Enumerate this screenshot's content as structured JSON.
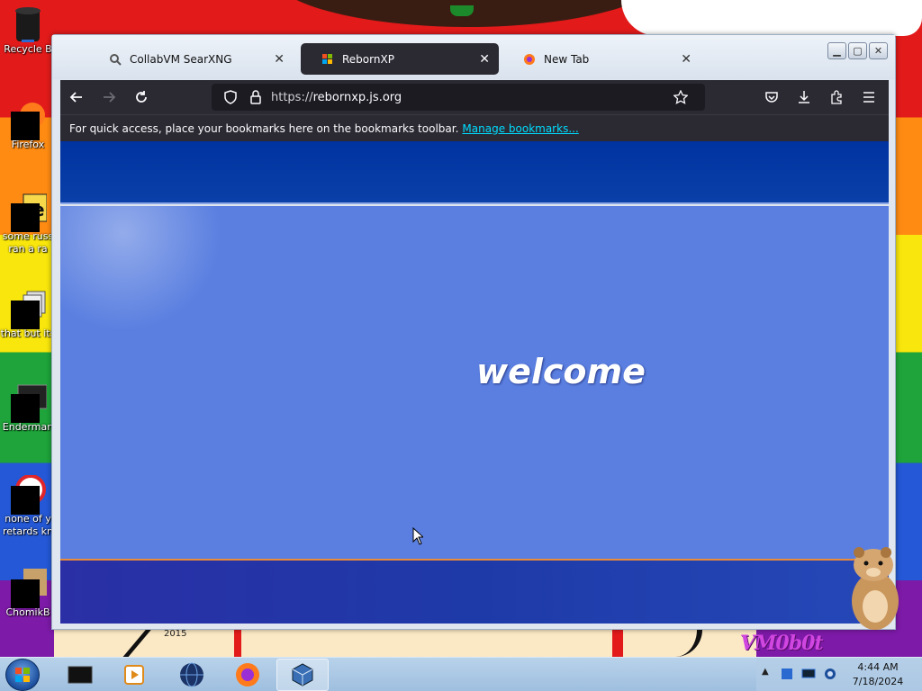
{
  "desktop": {
    "icons": [
      {
        "label": "Recycle B"
      },
      {
        "label": "Firefox"
      },
      {
        "label": "some russ ran a ra"
      },
      {
        "label": "that but its"
      },
      {
        "label": "Enderman"
      },
      {
        "label": "none of y retards kn"
      },
      {
        "label": "ChomikB"
      }
    ],
    "year_label": "2015",
    "vm_label": "VM0b0t"
  },
  "browser": {
    "tabs": [
      {
        "label": "CollabVM SearXNG",
        "icon": "searxng-icon",
        "active": false
      },
      {
        "label": "RebornXP",
        "icon": "windows-flag-icon",
        "active": true
      },
      {
        "label": "New Tab",
        "icon": "firefox-icon",
        "active": false
      }
    ],
    "url": {
      "scheme": "https://",
      "host": "rebornxp.js.org"
    },
    "bookmarks_bar": {
      "message": "For quick access, place your bookmarks here on the bookmarks toolbar.",
      "link": "Manage bookmarks..."
    },
    "page": {
      "welcome_text": "welcome"
    }
  },
  "taskbar": {
    "items": [
      "terminal-icon",
      "media-player-icon",
      "globe-icon",
      "firefox-icon",
      "virtualbox-icon"
    ],
    "active_index": 4,
    "clock": {
      "time": "4:44 AM",
      "date": "7/18/2024"
    }
  },
  "colors": {
    "browser_chrome": "#2b2a33",
    "page_blue": "#5a7fe0",
    "page_dark_blue": "#0033a0",
    "link": "#00ddff"
  }
}
